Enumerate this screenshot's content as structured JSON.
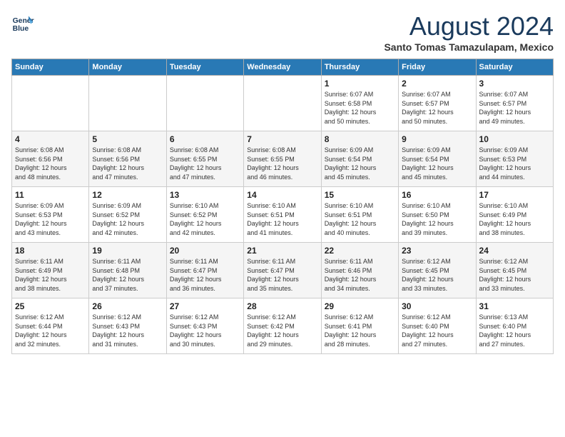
{
  "logo": {
    "line1": "General",
    "line2": "Blue"
  },
  "title": "August 2024",
  "location": "Santo Tomas Tamazulapam, Mexico",
  "days_of_week": [
    "Sunday",
    "Monday",
    "Tuesday",
    "Wednesday",
    "Thursday",
    "Friday",
    "Saturday"
  ],
  "weeks": [
    [
      {
        "day": "",
        "content": ""
      },
      {
        "day": "",
        "content": ""
      },
      {
        "day": "",
        "content": ""
      },
      {
        "day": "",
        "content": ""
      },
      {
        "day": "1",
        "content": "Sunrise: 6:07 AM\nSunset: 6:58 PM\nDaylight: 12 hours\nand 50 minutes."
      },
      {
        "day": "2",
        "content": "Sunrise: 6:07 AM\nSunset: 6:57 PM\nDaylight: 12 hours\nand 50 minutes."
      },
      {
        "day": "3",
        "content": "Sunrise: 6:07 AM\nSunset: 6:57 PM\nDaylight: 12 hours\nand 49 minutes."
      }
    ],
    [
      {
        "day": "4",
        "content": "Sunrise: 6:08 AM\nSunset: 6:56 PM\nDaylight: 12 hours\nand 48 minutes."
      },
      {
        "day": "5",
        "content": "Sunrise: 6:08 AM\nSunset: 6:56 PM\nDaylight: 12 hours\nand 47 minutes."
      },
      {
        "day": "6",
        "content": "Sunrise: 6:08 AM\nSunset: 6:55 PM\nDaylight: 12 hours\nand 47 minutes."
      },
      {
        "day": "7",
        "content": "Sunrise: 6:08 AM\nSunset: 6:55 PM\nDaylight: 12 hours\nand 46 minutes."
      },
      {
        "day": "8",
        "content": "Sunrise: 6:09 AM\nSunset: 6:54 PM\nDaylight: 12 hours\nand 45 minutes."
      },
      {
        "day": "9",
        "content": "Sunrise: 6:09 AM\nSunset: 6:54 PM\nDaylight: 12 hours\nand 45 minutes."
      },
      {
        "day": "10",
        "content": "Sunrise: 6:09 AM\nSunset: 6:53 PM\nDaylight: 12 hours\nand 44 minutes."
      }
    ],
    [
      {
        "day": "11",
        "content": "Sunrise: 6:09 AM\nSunset: 6:53 PM\nDaylight: 12 hours\nand 43 minutes."
      },
      {
        "day": "12",
        "content": "Sunrise: 6:09 AM\nSunset: 6:52 PM\nDaylight: 12 hours\nand 42 minutes."
      },
      {
        "day": "13",
        "content": "Sunrise: 6:10 AM\nSunset: 6:52 PM\nDaylight: 12 hours\nand 42 minutes."
      },
      {
        "day": "14",
        "content": "Sunrise: 6:10 AM\nSunset: 6:51 PM\nDaylight: 12 hours\nand 41 minutes."
      },
      {
        "day": "15",
        "content": "Sunrise: 6:10 AM\nSunset: 6:51 PM\nDaylight: 12 hours\nand 40 minutes."
      },
      {
        "day": "16",
        "content": "Sunrise: 6:10 AM\nSunset: 6:50 PM\nDaylight: 12 hours\nand 39 minutes."
      },
      {
        "day": "17",
        "content": "Sunrise: 6:10 AM\nSunset: 6:49 PM\nDaylight: 12 hours\nand 38 minutes."
      }
    ],
    [
      {
        "day": "18",
        "content": "Sunrise: 6:11 AM\nSunset: 6:49 PM\nDaylight: 12 hours\nand 38 minutes."
      },
      {
        "day": "19",
        "content": "Sunrise: 6:11 AM\nSunset: 6:48 PM\nDaylight: 12 hours\nand 37 minutes."
      },
      {
        "day": "20",
        "content": "Sunrise: 6:11 AM\nSunset: 6:47 PM\nDaylight: 12 hours\nand 36 minutes."
      },
      {
        "day": "21",
        "content": "Sunrise: 6:11 AM\nSunset: 6:47 PM\nDaylight: 12 hours\nand 35 minutes."
      },
      {
        "day": "22",
        "content": "Sunrise: 6:11 AM\nSunset: 6:46 PM\nDaylight: 12 hours\nand 34 minutes."
      },
      {
        "day": "23",
        "content": "Sunrise: 6:12 AM\nSunset: 6:45 PM\nDaylight: 12 hours\nand 33 minutes."
      },
      {
        "day": "24",
        "content": "Sunrise: 6:12 AM\nSunset: 6:45 PM\nDaylight: 12 hours\nand 33 minutes."
      }
    ],
    [
      {
        "day": "25",
        "content": "Sunrise: 6:12 AM\nSunset: 6:44 PM\nDaylight: 12 hours\nand 32 minutes."
      },
      {
        "day": "26",
        "content": "Sunrise: 6:12 AM\nSunset: 6:43 PM\nDaylight: 12 hours\nand 31 minutes."
      },
      {
        "day": "27",
        "content": "Sunrise: 6:12 AM\nSunset: 6:43 PM\nDaylight: 12 hours\nand 30 minutes."
      },
      {
        "day": "28",
        "content": "Sunrise: 6:12 AM\nSunset: 6:42 PM\nDaylight: 12 hours\nand 29 minutes."
      },
      {
        "day": "29",
        "content": "Sunrise: 6:12 AM\nSunset: 6:41 PM\nDaylight: 12 hours\nand 28 minutes."
      },
      {
        "day": "30",
        "content": "Sunrise: 6:12 AM\nSunset: 6:40 PM\nDaylight: 12 hours\nand 27 minutes."
      },
      {
        "day": "31",
        "content": "Sunrise: 6:13 AM\nSunset: 6:40 PM\nDaylight: 12 hours\nand 27 minutes."
      }
    ]
  ]
}
